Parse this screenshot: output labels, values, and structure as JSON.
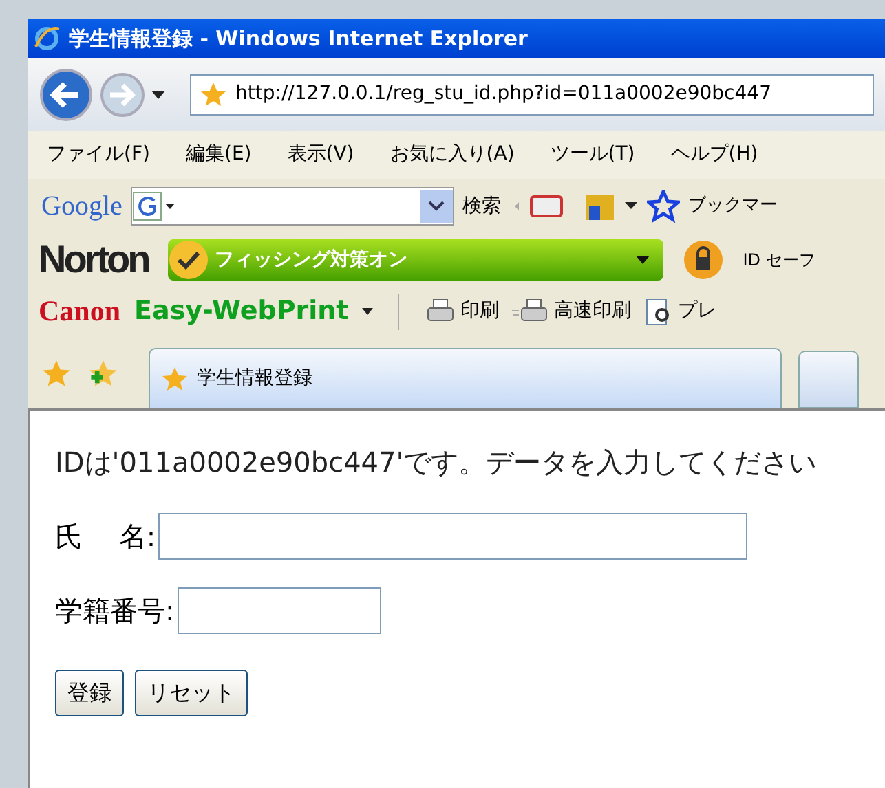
{
  "window": {
    "title": "学生情報登録 - Windows Internet Explorer"
  },
  "address_bar": {
    "url": "http://127.0.0.1/reg_stu_id.php?id=011a0002e90bc447"
  },
  "menu": [
    "ファイル(F)",
    "編集(E)",
    "表示(V)",
    "お気に入り(A)",
    "ツール(T)",
    "ヘルプ(H)"
  ],
  "google_toolbar": {
    "logo": "Google",
    "search_button": "検索",
    "bookmarks": "ブックマー"
  },
  "norton_toolbar": {
    "logo": "Norton",
    "phishing_status": "フィッシング対策オン",
    "id_safe": "ID セーフ"
  },
  "canon_toolbar": {
    "logo": "Canon",
    "product": "Easy-WebPrint",
    "print": "印刷",
    "fast_print": "高速印刷",
    "preview": "プレ"
  },
  "tabs": [
    {
      "label": "学生情報登録",
      "selected": true
    }
  ],
  "page": {
    "message": "IDは'011a0002e90bc447'です。データを入力してください",
    "fields": [
      {
        "label": "氏　 名:",
        "kind": "wide"
      },
      {
        "label": "学籍番号:",
        "kind": "narrow"
      }
    ],
    "buttons": [
      "登録",
      "リセット"
    ]
  }
}
